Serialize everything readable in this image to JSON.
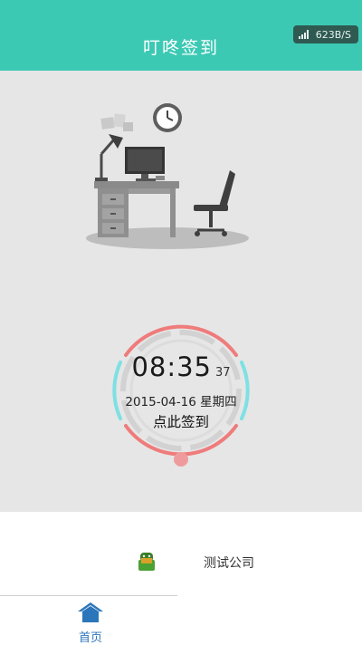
{
  "status_bar": {
    "net_speed": "623B/S"
  },
  "header": {
    "title": "叮咚签到"
  },
  "clock": {
    "hour_minute": "08:35",
    "seconds": "37",
    "date": "2015-04-16",
    "weekday": "星期四",
    "checkin_label": "点此签到"
  },
  "company": {
    "name": "测试公司",
    "icon": "android-icon"
  },
  "tabbar": {
    "home_label": "首页",
    "home_icon": "home-icon"
  },
  "colors": {
    "header": "#3cc9b4",
    "ring_red": "#ef7b7b",
    "ring_cyan": "#7fe0e3",
    "tab_active": "#2b76ba"
  }
}
